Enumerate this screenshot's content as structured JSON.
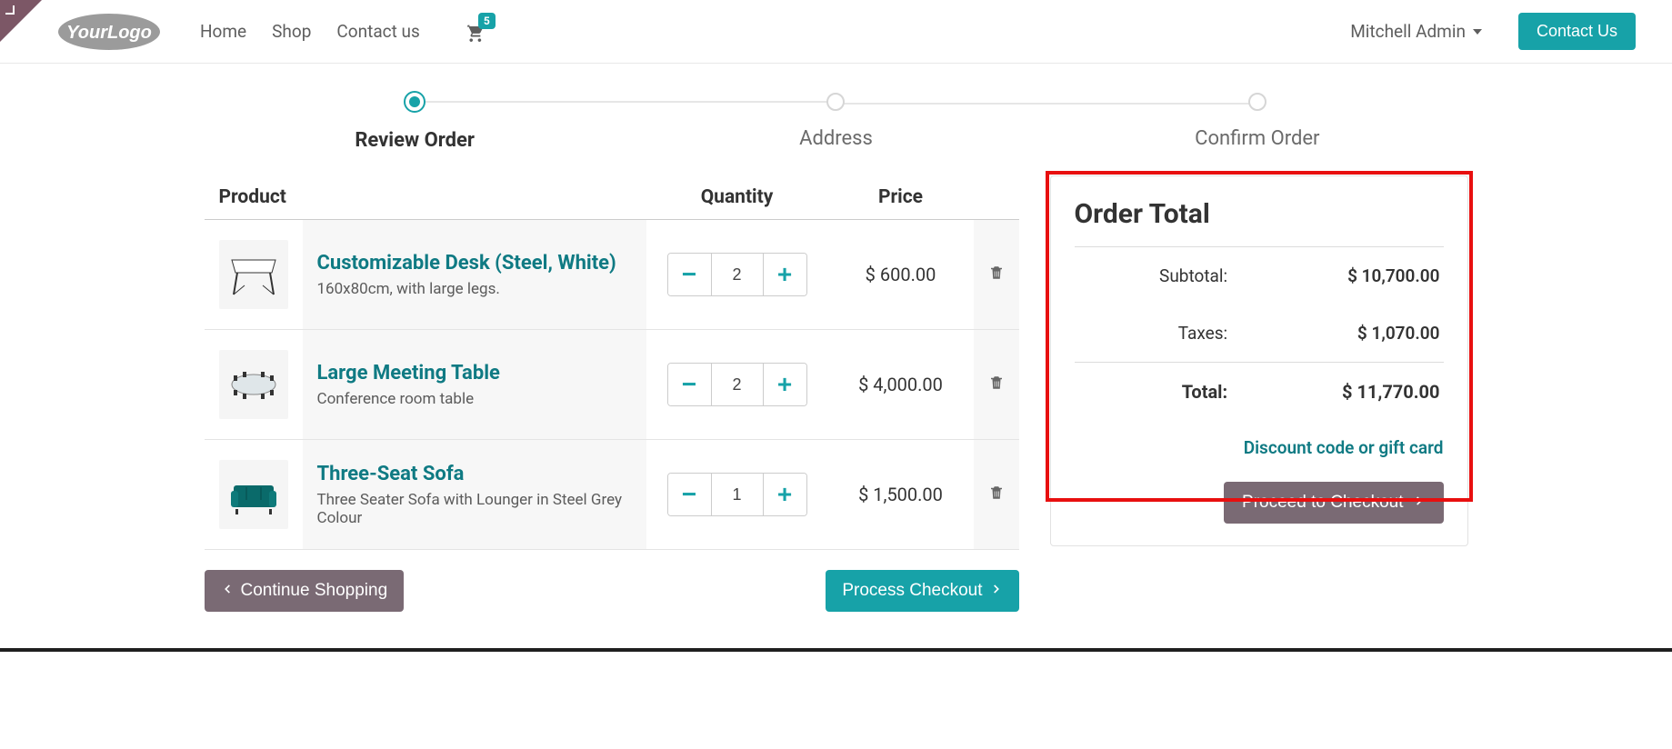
{
  "nav": {
    "links": [
      "Home",
      "Shop",
      "Contact us"
    ],
    "cart_count": "5",
    "user": "Mitchell Admin",
    "contact_btn": "Contact Us"
  },
  "steps": [
    {
      "label": "Review Order",
      "active": true
    },
    {
      "label": "Address",
      "active": false
    },
    {
      "label": "Confirm Order",
      "active": false
    }
  ],
  "table": {
    "headers": {
      "product": "Product",
      "quantity": "Quantity",
      "price": "Price"
    }
  },
  "items": [
    {
      "name": "Customizable Desk (Steel, White)",
      "desc": "160x80cm, with large legs.",
      "qty": "2",
      "price": "$ 600.00",
      "icon": "desk"
    },
    {
      "name": "Large Meeting Table",
      "desc": "Conference room table",
      "qty": "2",
      "price": "$ 4,000.00",
      "icon": "table"
    },
    {
      "name": "Three-Seat Sofa",
      "desc": "Three Seater Sofa with Lounger in Steel Grey Colour",
      "qty": "1",
      "price": "$ 1,500.00",
      "icon": "sofa"
    }
  ],
  "actions": {
    "continue": "Continue Shopping",
    "process": "Process Checkout"
  },
  "order_total": {
    "title": "Order Total",
    "subtotal_label": "Subtotal:",
    "subtotal_value": "$ 10,700.00",
    "taxes_label": "Taxes:",
    "taxes_value": "$ 1,070.00",
    "total_label": "Total:",
    "total_value": "$ 11,770.00",
    "discount_link": "Discount code or gift card",
    "proceed": "Proceed to Checkout"
  }
}
